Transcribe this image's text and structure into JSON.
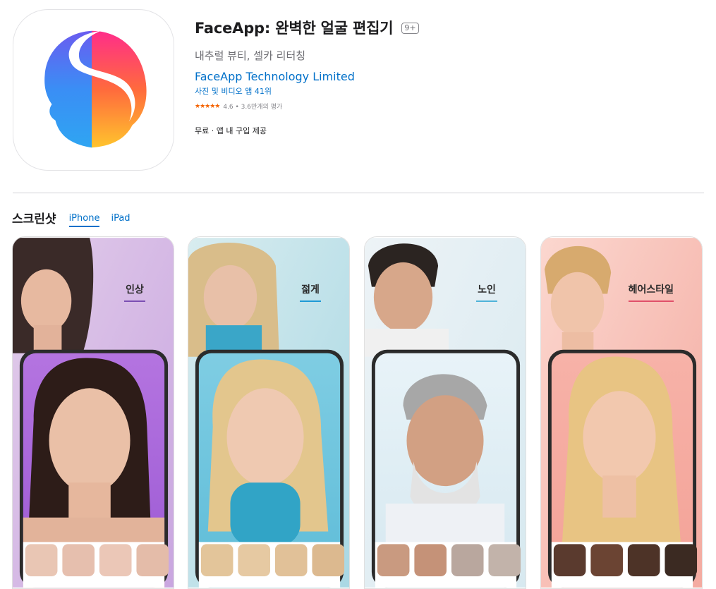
{
  "app": {
    "title": "FaceApp: 완벽한 얼굴 편집기",
    "age_rating": "9+",
    "subtitle": "내추럴 뷰티, 셀카 리터칭",
    "developer": "FaceApp Technology Limited",
    "ranking": "사진 및 비디오 앱 41위",
    "rating_stars": "★★★★★",
    "rating_text": "4.6 • 3.6만개의 평가",
    "rating_value": 4.6,
    "price": "무료 · 앱 내 구입 제공"
  },
  "screenshots_section": {
    "title": "스크린샷",
    "tabs": [
      "iPhone",
      "iPad"
    ],
    "active_tab": "iPhone"
  },
  "screenshots": [
    {
      "label": "인상",
      "underline_color": "#7b4fb3"
    },
    {
      "label": "젊게",
      "underline_color": "#1f9ad6"
    },
    {
      "label": "노인",
      "underline_color": "#4fb3d9"
    },
    {
      "label": "헤어스타일",
      "underline_color": "#e0506a"
    }
  ]
}
